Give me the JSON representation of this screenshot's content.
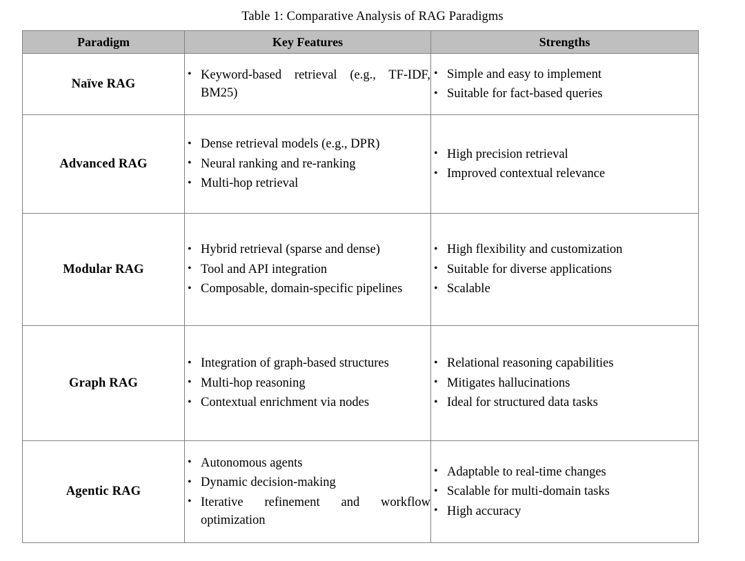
{
  "caption": "Table 1: Comparative Analysis of RAG Paradigms",
  "colors": {
    "header_background": "#bfbfbf",
    "border": "#808080",
    "page_background": "#ffffff",
    "text": "#000000"
  },
  "table": {
    "headers": [
      "Paradigm",
      "Key Features",
      "Strengths"
    ],
    "rows": [
      {
        "paradigm": "Naïve RAG",
        "key_features": [
          "Keyword-based retrieval (e.g., TF-IDF, BM25)"
        ],
        "strengths": [
          "Simple and easy to implement",
          "Suitable for fact-based queries"
        ]
      },
      {
        "paradigm": "Advanced RAG",
        "key_features": [
          "Dense retrieval models (e.g., DPR)",
          "Neural ranking and re-ranking",
          "Multi-hop retrieval"
        ],
        "strengths": [
          "High precision retrieval",
          "Improved contextual relevance"
        ]
      },
      {
        "paradigm": "Modular RAG",
        "key_features": [
          "Hybrid retrieval (sparse and dense)",
          "Tool and API integration",
          "Composable, domain-specific pipelines"
        ],
        "strengths": [
          "High flexibility and customization",
          "Suitable for diverse applications",
          "Scalable"
        ]
      },
      {
        "paradigm": "Graph RAG",
        "key_features": [
          "Integration of graph-based structures",
          "Multi-hop reasoning",
          "Contextual enrichment via nodes"
        ],
        "strengths": [
          "Relational reasoning capabilities",
          "Mitigates hallucinations",
          "Ideal for structured data tasks"
        ]
      },
      {
        "paradigm": "Agentic RAG",
        "key_features": [
          "Autonomous agents",
          "Dynamic decision-making",
          "Iterative refinement and work­flow optimization"
        ],
        "strengths": [
          "Adaptable to real-time changes",
          "Scalable for multi-domain tasks",
          "High accuracy"
        ]
      }
    ]
  }
}
